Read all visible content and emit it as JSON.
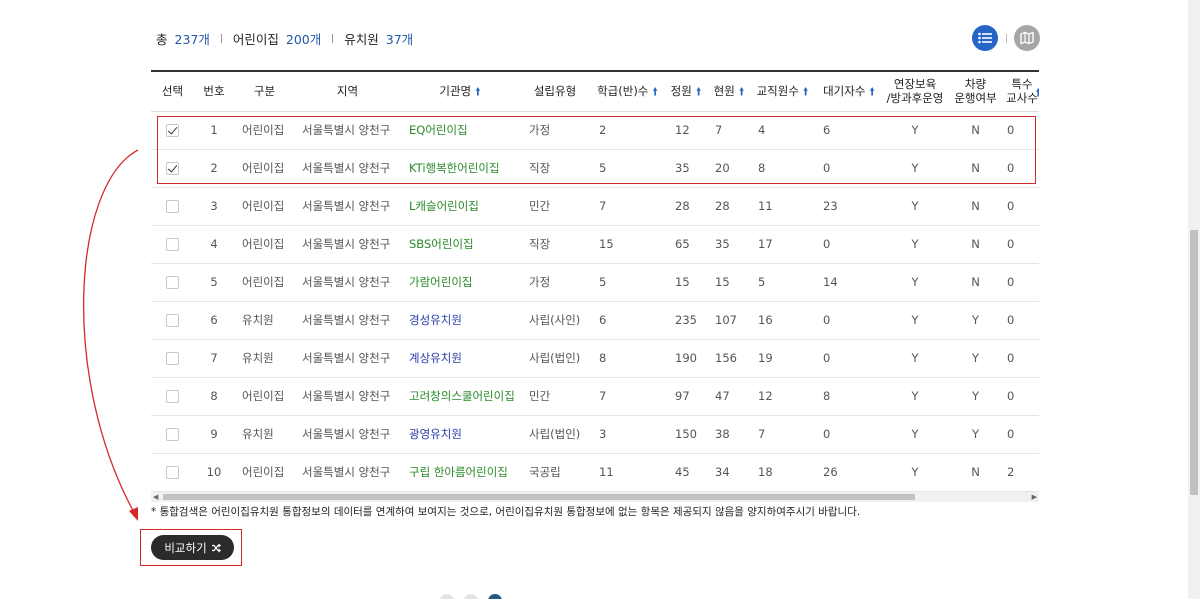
{
  "summary": {
    "total_label": "총",
    "total_value": "237개",
    "daycare_label": "어린이집",
    "daycare_value": "200개",
    "kinder_label": "유치원",
    "kinder_value": "37개"
  },
  "view_toggle": {
    "list_icon": "list-icon",
    "map_icon": "map-icon",
    "active": "list"
  },
  "table": {
    "headers": {
      "select": "선택",
      "no": "번호",
      "category": "구분",
      "region": "지역",
      "name": "기관명",
      "type": "설립유형",
      "classes": "학급(반)수",
      "capacity": "정원",
      "current": "현원",
      "teachers": "교직원수",
      "waiting": "대기자수",
      "extended_1": "연장보육",
      "extended_2": "/방과후운영",
      "vehicle_1": "차량",
      "vehicle_2": "운행여부",
      "special_1": "특수",
      "special_2": "교사수",
      "sort_icon": "arrow-up-icon"
    },
    "rows": [
      {
        "checked": true,
        "no": "1",
        "category": "어린이집",
        "region": "서울특별시 양천구",
        "name": "EQ어린이집",
        "name_color": "#2a8a2a",
        "type": "가정",
        "classes": "2",
        "capacity": "12",
        "current": "7",
        "teachers": "4",
        "waiting": "6",
        "extended": "Y",
        "vehicle": "N",
        "special": "0"
      },
      {
        "checked": true,
        "no": "2",
        "category": "어린이집",
        "region": "서울특별시 양천구",
        "name": "KTi행복한어린이집",
        "name_color": "#2a8a2a",
        "type": "직장",
        "classes": "5",
        "capacity": "35",
        "current": "20",
        "teachers": "8",
        "waiting": "0",
        "extended": "Y",
        "vehicle": "N",
        "special": "0"
      },
      {
        "checked": false,
        "no": "3",
        "category": "어린이집",
        "region": "서울특별시 양천구",
        "name": "L캐슬어린이집",
        "name_color": "#2a8a2a",
        "type": "민간",
        "classes": "7",
        "capacity": "28",
        "current": "28",
        "teachers": "11",
        "waiting": "23",
        "extended": "Y",
        "vehicle": "N",
        "special": "0"
      },
      {
        "checked": false,
        "no": "4",
        "category": "어린이집",
        "region": "서울특별시 양천구",
        "name": "SBS어린이집",
        "name_color": "#2a8a2a",
        "type": "직장",
        "classes": "15",
        "capacity": "65",
        "current": "35",
        "teachers": "17",
        "waiting": "0",
        "extended": "Y",
        "vehicle": "N",
        "special": "0"
      },
      {
        "checked": false,
        "no": "5",
        "category": "어린이집",
        "region": "서울특별시 양천구",
        "name": "가람어린이집",
        "name_color": "#2a8a2a",
        "type": "가정",
        "classes": "5",
        "capacity": "15",
        "current": "15",
        "teachers": "5",
        "waiting": "14",
        "extended": "Y",
        "vehicle": "N",
        "special": "0"
      },
      {
        "checked": false,
        "no": "6",
        "category": "유치원",
        "region": "서울특별시 양천구",
        "name": "경성유치원",
        "name_color": "#2a3fa8",
        "type": "사립(사인)",
        "classes": "6",
        "capacity": "235",
        "current": "107",
        "teachers": "16",
        "waiting": "0",
        "extended": "Y",
        "vehicle": "Y",
        "special": "0"
      },
      {
        "checked": false,
        "no": "7",
        "category": "유치원",
        "region": "서울특별시 양천구",
        "name": "계상유치원",
        "name_color": "#2a3fa8",
        "type": "사립(법인)",
        "classes": "8",
        "capacity": "190",
        "current": "156",
        "teachers": "19",
        "waiting": "0",
        "extended": "Y",
        "vehicle": "Y",
        "special": "0"
      },
      {
        "checked": false,
        "no": "8",
        "category": "어린이집",
        "region": "서울특별시 양천구",
        "name": "고려창의스쿨어린이집",
        "name_color": "#2a8a2a",
        "type": "민간",
        "classes": "7",
        "capacity": "97",
        "current": "47",
        "teachers": "12",
        "waiting": "8",
        "extended": "Y",
        "vehicle": "Y",
        "special": "0"
      },
      {
        "checked": false,
        "no": "9",
        "category": "유치원",
        "region": "서울특별시 양천구",
        "name": "광영유치원",
        "name_color": "#2a3fa8",
        "type": "사립(법인)",
        "classes": "3",
        "capacity": "150",
        "current": "38",
        "teachers": "7",
        "waiting": "0",
        "extended": "Y",
        "vehicle": "Y",
        "special": "0"
      },
      {
        "checked": false,
        "no": "10",
        "category": "어린이집",
        "region": "서울특별시 양천구",
        "name": "구립 한아름어린이집",
        "name_color": "#2a8a2a",
        "type": "국공립",
        "classes": "11",
        "capacity": "45",
        "current": "34",
        "teachers": "18",
        "waiting": "26",
        "extended": "Y",
        "vehicle": "N",
        "special": "2"
      }
    ]
  },
  "notice": "* 통합검색은 어린이집유치원 통합정보의 데이터를 연계하여 보여지는 것으로, 어린이집유치원 통합정보에 없는 항목은 제공되지 않음을 양지하여주시기 바랍니다.",
  "compare_button": {
    "label": "비교하기",
    "icon": "shuffle-icon"
  },
  "annotation_color": "#d4282a"
}
